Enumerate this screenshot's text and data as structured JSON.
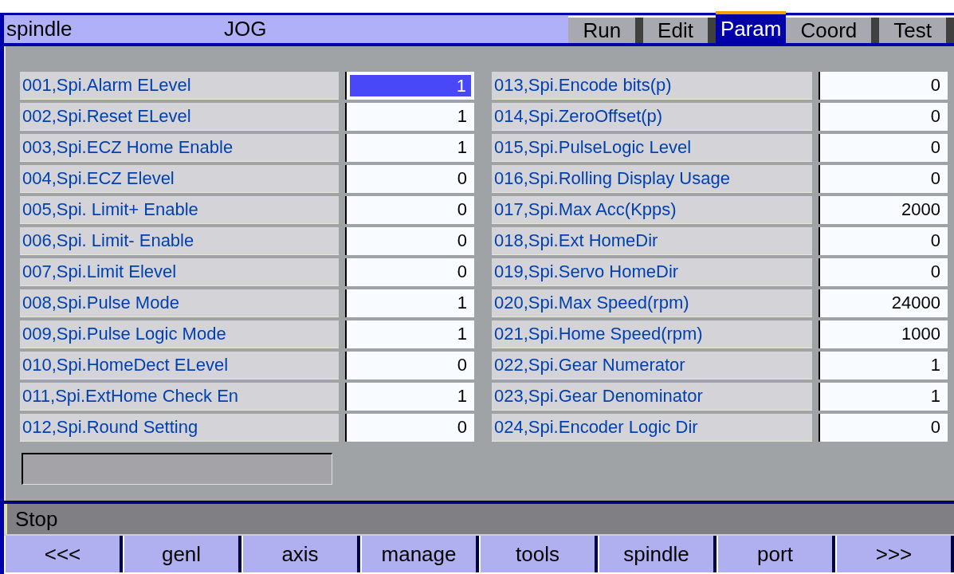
{
  "header": {
    "module": "spindle",
    "mode": "JOG"
  },
  "tabs": [
    {
      "label": "Run",
      "selected": false
    },
    {
      "label": "Edit",
      "selected": false
    },
    {
      "label": "Param",
      "selected": true
    },
    {
      "label": "Coord",
      "selected": false
    },
    {
      "label": "Test",
      "selected": false
    }
  ],
  "params": [
    {
      "label": "001,Spi.Alarm ELevel",
      "value": "1",
      "selected": true
    },
    {
      "label": "002,Spi.Reset ELevel",
      "value": "1",
      "selected": false
    },
    {
      "label": "003,Spi.ECZ Home Enable",
      "value": "1",
      "selected": false
    },
    {
      "label": "004,Spi.ECZ Elevel",
      "value": "0",
      "selected": false
    },
    {
      "label": "005,Spi. Limit+ Enable",
      "value": "0",
      "selected": false
    },
    {
      "label": "006,Spi. Limit- Enable",
      "value": "0",
      "selected": false
    },
    {
      "label": "007,Spi.Limit Elevel",
      "value": "0",
      "selected": false
    },
    {
      "label": "008,Spi.Pulse Mode",
      "value": "1",
      "selected": false
    },
    {
      "label": "009,Spi.Pulse Logic Mode",
      "value": "1",
      "selected": false
    },
    {
      "label": "010,Spi.HomeDect ELevel",
      "value": "0",
      "selected": false
    },
    {
      "label": "011,Spi.ExtHome Check En",
      "value": "1",
      "selected": false
    },
    {
      "label": "012,Spi.Round Setting",
      "value": "0",
      "selected": false
    },
    {
      "label": "013,Spi.Encode bits(p)",
      "value": "0",
      "selected": false
    },
    {
      "label": "014,Spi.ZeroOffset(p)",
      "value": "0",
      "selected": false
    },
    {
      "label": "015,Spi.PulseLogic Level",
      "value": "0",
      "selected": false
    },
    {
      "label": "016,Spi.Rolling Display Usage",
      "value": "0",
      "selected": false
    },
    {
      "label": "017,Spi.Max Acc(Kpps)",
      "value": "2000",
      "selected": false
    },
    {
      "label": "018,Spi.Ext HomeDir",
      "value": "0",
      "selected": false
    },
    {
      "label": "019,Spi.Servo HomeDir",
      "value": "0",
      "selected": false
    },
    {
      "label": "020,Spi.Max Speed(rpm)",
      "value": "24000",
      "selected": false
    },
    {
      "label": "021,Spi.Home Speed(rpm)",
      "value": "1000",
      "selected": false
    },
    {
      "label": "022,Spi.Gear Numerator",
      "value": "1",
      "selected": false
    },
    {
      "label": "023,Spi.Gear Denominator",
      "value": "1",
      "selected": false
    },
    {
      "label": "024,Spi.Encoder Logic Dir",
      "value": "0",
      "selected": false
    }
  ],
  "status_bar": "Stop",
  "softkeys": [
    "<<<",
    "genl",
    "axis",
    "manage",
    "tools",
    "spindle",
    "port",
    ">>>"
  ]
}
